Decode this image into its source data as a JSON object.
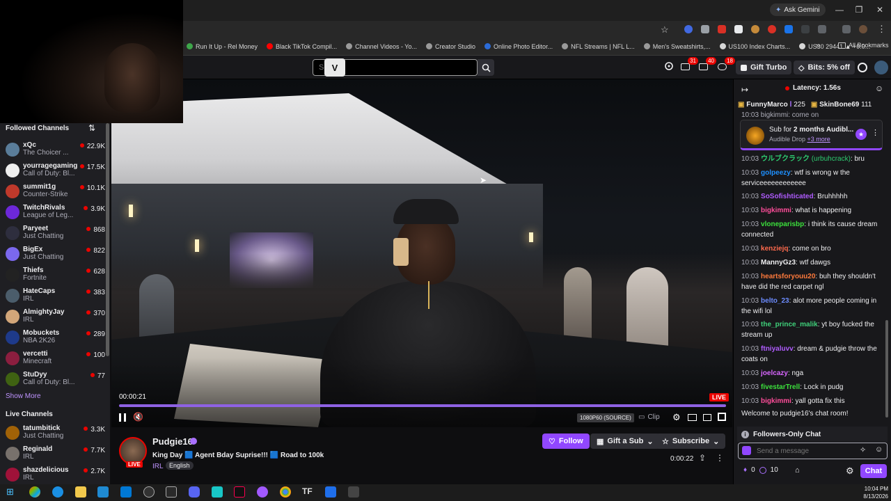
{
  "browser": {
    "ask_gemini": "Ask Gemini",
    "bookmarks": [
      {
        "label": "Run It Up - Rel Money",
        "color": "#3ea64a"
      },
      {
        "label": "Black TikTok Compil...",
        "color": "#ff0000"
      },
      {
        "label": "Channel Videos - Yo...",
        "color": "#9a9a9a"
      },
      {
        "label": "Creator Studio",
        "color": "#9a9a9a"
      },
      {
        "label": "Online Photo Editor...",
        "color": "#2b6bd8"
      },
      {
        "label": "NFL Streams | NFL L...",
        "color": "#9a9a9a"
      },
      {
        "label": "Men's Sweatshirts,...",
        "color": "#9a9a9a"
      },
      {
        "label": "US100 Index Charts...",
        "color": "#d7d7d7"
      },
      {
        "label": "US30 29441 ▲ +0.0...",
        "color": "#d7d7d7"
      }
    ],
    "all_bookmarks": "All Bookmarks",
    "more_chevron": "»"
  },
  "twitch_nav": {
    "search_placeholder": "Search",
    "notifications": [
      {
        "count": "31"
      },
      {
        "count": "40"
      },
      {
        "count": "18"
      }
    ],
    "gift_turbo": "Gift Turbo",
    "bits": "Bits: 5% off"
  },
  "sidebar": {
    "followed_title": "Followed Channels",
    "followed": [
      {
        "name": "xQc",
        "game": "The Choicer ...",
        "viewers": "22.9K",
        "color": "#5a7d9a"
      },
      {
        "name": "yourragegaming",
        "game": "Call of Duty: Bl...",
        "viewers": "17.5K",
        "color": "#f0f0f0"
      },
      {
        "name": "summit1g",
        "game": "Counter-Strike",
        "viewers": "10.1K",
        "color": "#c0392b"
      },
      {
        "name": "TwitchRivals",
        "game": "League of Leg...",
        "viewers": "3.9K",
        "color": "#6d28d9"
      },
      {
        "name": "Paryeet",
        "game": "Just Chatting",
        "viewers": "868",
        "color": "#2e2e3e"
      },
      {
        "name": "BigEx",
        "game": "Just Chatting",
        "viewers": "822",
        "color": "#7b68ee"
      },
      {
        "name": "Thiefs",
        "game": "Fortnite",
        "viewers": "628",
        "color": "#222222"
      },
      {
        "name": "HateCaps",
        "game": "IRL",
        "viewers": "383",
        "color": "#4b5d6b"
      },
      {
        "name": "AlmightyJay",
        "game": "IRL",
        "viewers": "370",
        "color": "#d2a679"
      },
      {
        "name": "Mobuckets",
        "game": "NBA 2K26",
        "viewers": "289",
        "color": "#1e3a8a"
      },
      {
        "name": "vercetti",
        "game": "Minecraft",
        "viewers": "100",
        "color": "#8b1e3f"
      },
      {
        "name": "StuDyy",
        "game": "Call of Duty: Bl...",
        "viewers": "77",
        "color": "#3f6212"
      }
    ],
    "show_more": "Show More",
    "live_title": "Live Channels",
    "live": [
      {
        "name": "tatumbitick",
        "game": "Just Chatting",
        "viewers": "3.3K",
        "color": "#a16207"
      },
      {
        "name": "Reginald",
        "game": "IRL",
        "viewers": "7.7K",
        "color": "#78716c"
      },
      {
        "name": "shazdelicious",
        "game": "IRL",
        "viewers": "2.7K",
        "color": "#9f1239"
      }
    ]
  },
  "player": {
    "time": "00:00:21",
    "live_badge": "LIVE",
    "quality": "1080P60 (SOURCE)",
    "clip": "Clip",
    "progress": 1.0
  },
  "stream": {
    "channel": "Pudgie16",
    "title": "King Day 🟦 Agent Bday Suprise!!! 🟦 Road to 100k",
    "category": "IRL",
    "tag": "English",
    "live_badge": "LIVE",
    "follow": "Follow",
    "gift_sub": "Gift a Sub",
    "subscribe": "Subscribe",
    "uptime": "0:00:22"
  },
  "chat": {
    "latency": "Latency: 1.56s",
    "leaderboard": [
      {
        "name": "FunnyMarco",
        "count": "225"
      },
      {
        "name": "SkinBone69",
        "count": "111"
      }
    ],
    "partial_top": "10:03 bigkimmi: come on",
    "drop": {
      "title_prefix": "Sub for ",
      "title_bold": "2 months Audibl...",
      "source": "Audible Drop",
      "more": "+3 more"
    },
    "messages": [
      {
        "time": "10:03",
        "user": "ウルブクラック",
        "alt": " (urbuhcrack)",
        "text": ": bru",
        "color": "#2ecc71"
      },
      {
        "time": "10:03",
        "user": "golpeezy",
        "text": ": wtf is wrong w the serviceeeeeeeeeeee",
        "color": "#1e90ff"
      },
      {
        "time": "10:03",
        "user": "SoSofishticated",
        "text": ": Bruhhhhh",
        "color": "#b05cff"
      },
      {
        "time": "10:03",
        "user": "bigkimmi",
        "text": ": what is happening",
        "color": "#ff4d9a"
      },
      {
        "time": "10:03",
        "user": "vloneparisbp",
        "text": ": i think its cause dream connected",
        "color": "#3ce03c"
      },
      {
        "time": "10:03",
        "user": "kenziejq",
        "text": ": come on bro",
        "color": "#ff6a4d"
      },
      {
        "time": "10:03",
        "user": "MannyGz3",
        "text": ": wtf dawgs",
        "color": "#efeff1"
      },
      {
        "time": "10:03",
        "user": "heartsforyouu20",
        "text": ": buh they shouldn't have did the red carpet ngl",
        "color": "#ff7a3c"
      },
      {
        "time": "10:03",
        "user": "belto_23",
        "text": ": alot more people coming in the wifi lol",
        "color": "#6c8cff"
      },
      {
        "time": "10:03",
        "user": "the_prince_malik",
        "text": ": yt boy fucked the stream up",
        "color": "#3fd07a"
      },
      {
        "time": "10:03",
        "user": "ftniyaluvv",
        "text": ": dream & pudgie throw the coats on",
        "color": "#b05cff"
      },
      {
        "time": "10:03",
        "user": "joelcazy",
        "text": ": nga",
        "color": "#d966ff"
      },
      {
        "time": "10:03",
        "user": "fivestarTrell",
        "text": ": Lock in pudg",
        "color": "#3ce03c"
      },
      {
        "time": "10:03",
        "user": "bigkimmi",
        "text": ": yall gotta fix this",
        "color": "#ff4d9a"
      }
    ],
    "welcome": "Welcome to pudgie16's chat room!",
    "followers_only": "Followers-Only Chat",
    "input_placeholder": "Send a message",
    "points": "0",
    "bits_count": "10",
    "chat_button": "Chat"
  },
  "taskbar": {
    "time": "10:04 PM",
    "date": "8/13/2026"
  }
}
